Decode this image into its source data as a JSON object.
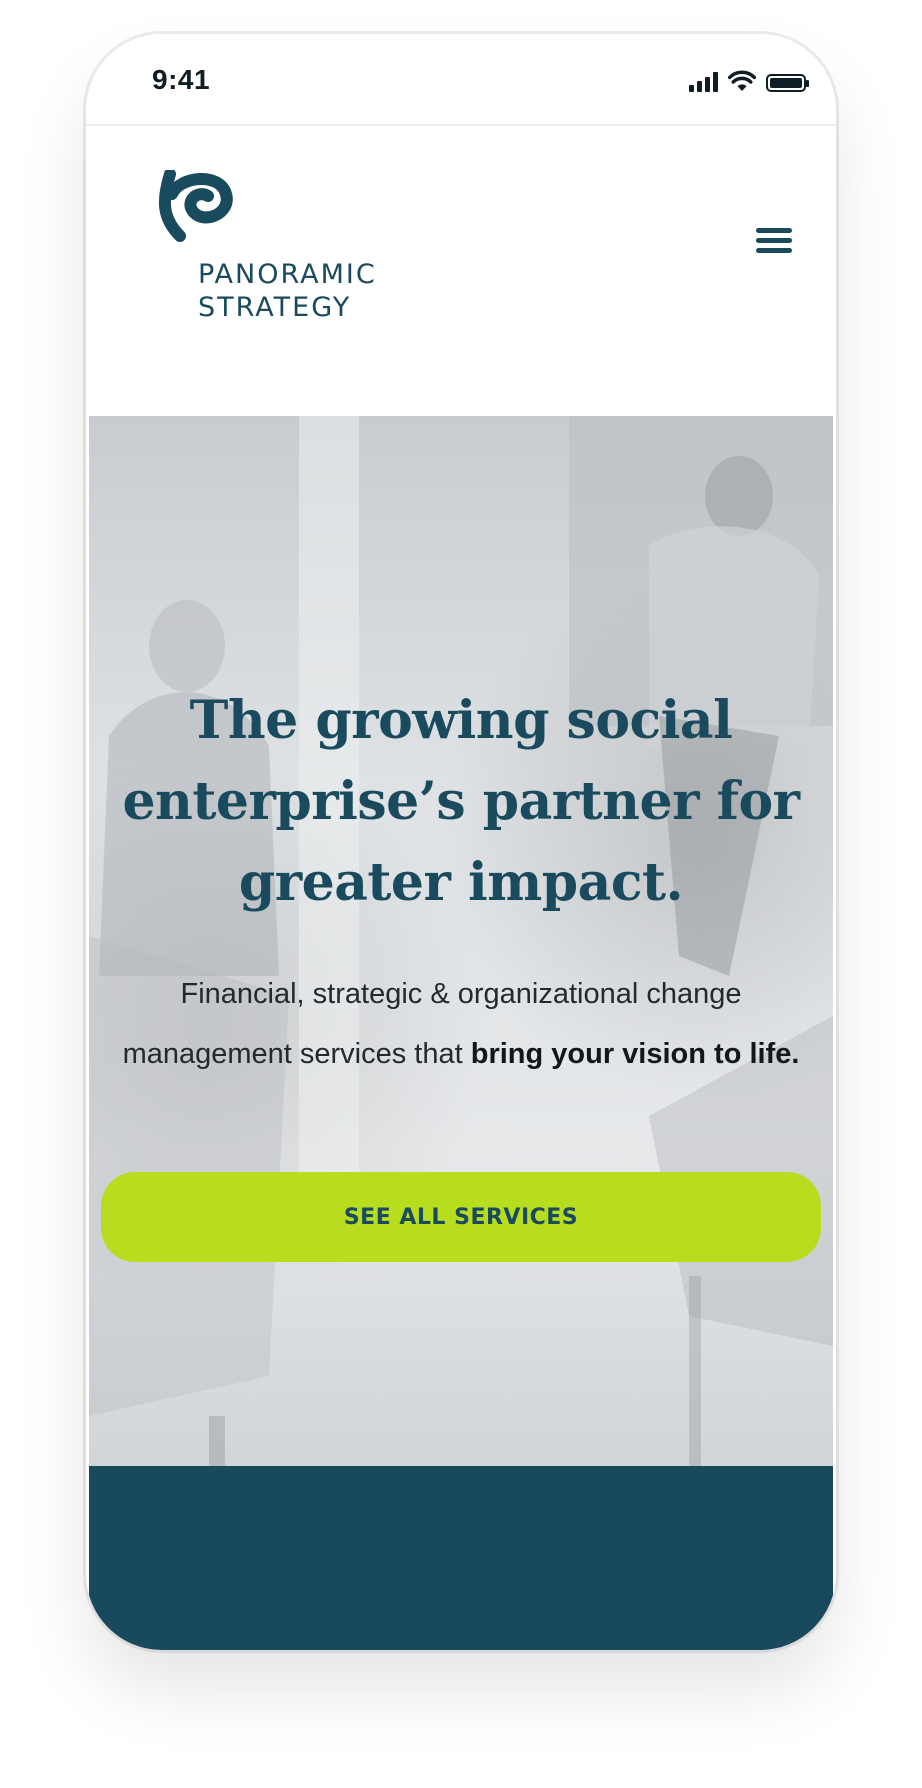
{
  "status_bar": {
    "time": "9:41",
    "icons": [
      "cellular-signal-icon",
      "wifi-icon",
      "battery-icon"
    ],
    "battery_level": 1.0
  },
  "header": {
    "logo_line1": "PANORAMIC",
    "logo_line2": "STRATEGY",
    "menu_icon": "hamburger-menu-icon"
  },
  "hero": {
    "headline": "The growing social enterprise’s partner for greater impact.",
    "subtext_regular": "Financial, strategic & organizational change management services that ",
    "subtext_bold": "bring your vision to life.",
    "cta_label": "SEE ALL SERVICES"
  },
  "colors": {
    "brand_dark": "#194a5e",
    "accent_lime": "#b8dd1f",
    "band": "#19495d",
    "text_dark": "#222a30"
  }
}
